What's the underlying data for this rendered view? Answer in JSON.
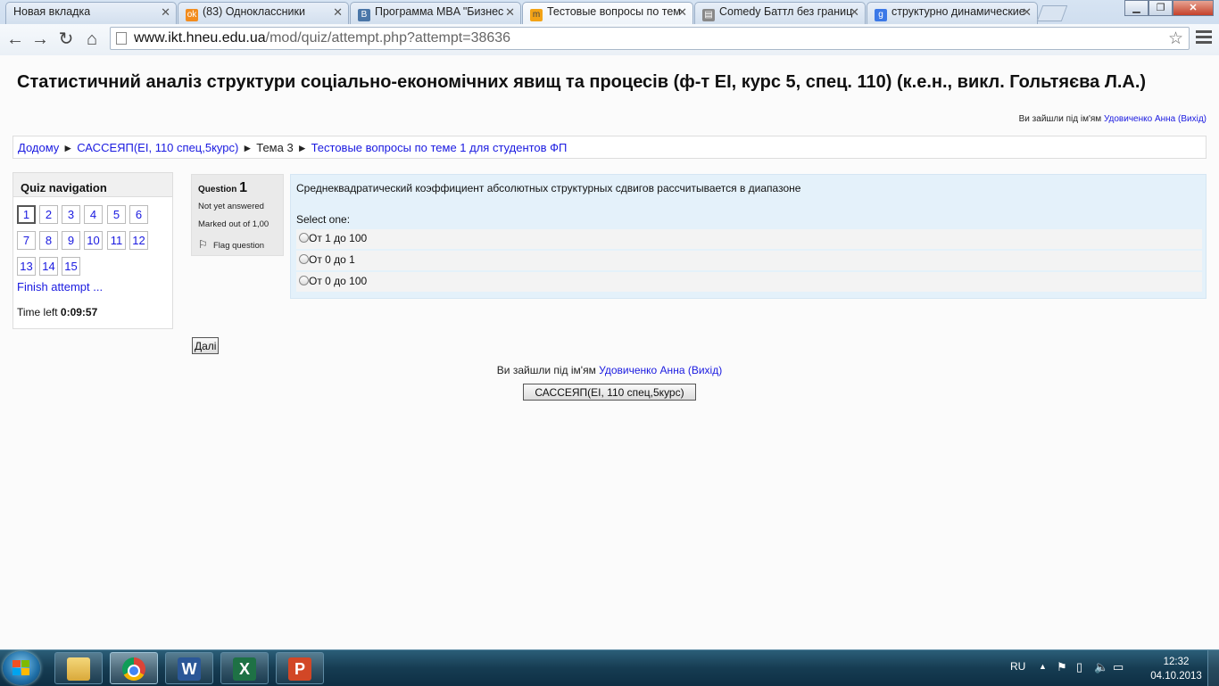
{
  "browser": {
    "tabs": [
      {
        "title": "Новая вкладка",
        "icon": "blank-page-icon",
        "active": false
      },
      {
        "title": "(83) Одноклассники",
        "icon": "odnoklassniki-icon",
        "active": false
      },
      {
        "title": "Программа MBA \"Бизнес",
        "icon": "vk-icon",
        "active": false
      },
      {
        "title": "Тестовые вопросы по теме",
        "icon": "moodle-icon",
        "active": true
      },
      {
        "title": "Comedy Баттл без границ",
        "icon": "film-icon",
        "active": false
      },
      {
        "title": "структурно динамические",
        "icon": "google-icon",
        "active": false
      }
    ],
    "url_host": "www.ikt.hneu.edu.ua",
    "url_path": "/mod/quiz/attempt.php?attempt=38636"
  },
  "page": {
    "course_title": "Статистичний аналіз структури соціально-економічних явищ та процесів (ф-т ЕІ, курс 5, спец. 110) (к.е.н., викл. Гольтяєва Л.А.)",
    "login_prefix": "Ви зайшли під ім'ям",
    "user_name": "Удовиченко Анна",
    "logout": "(Вихід)",
    "breadcrumb": [
      {
        "label": "Додому",
        "link": true
      },
      {
        "label": "САССЕЯП(ЕІ, 110 спец,5курс)",
        "link": true
      },
      {
        "label": "Тема 3",
        "link": false
      },
      {
        "label": "Тестовые вопросы по теме 1 для студентов ФП",
        "link": true
      }
    ],
    "breadcrumb_sep": "►"
  },
  "quiz_nav": {
    "title": "Quiz navigation",
    "questions": [
      "1",
      "2",
      "3",
      "4",
      "5",
      "6",
      "7",
      "8",
      "9",
      "10",
      "11",
      "12",
      "13",
      "14",
      "15"
    ],
    "current": "1",
    "finish_label": "Finish attempt ...",
    "time_label": "Time left",
    "time_value": "0:09:57"
  },
  "question": {
    "label": "Question",
    "number": "1",
    "state": "Not yet answered",
    "grade": "Marked out of 1,00",
    "flag_label": "Flag question",
    "text": "Среднеквадратический коэффициент абсолютных структурных сдвигов рассчитывается в диапазоне",
    "prompt": "Select one:",
    "answers": [
      "От 1 до 100",
      "От 0 до 1",
      "От 0 до 100"
    ]
  },
  "buttons": {
    "next": "Далі",
    "course": "САССЕЯП(ЕІ, 110 спец,5курс)"
  },
  "taskbar": {
    "apps": [
      "explorer-icon",
      "chrome-icon",
      "word-icon",
      "excel-icon",
      "powerpoint-icon"
    ],
    "lang": "RU",
    "time": "12:32",
    "date": "04.10.2013"
  }
}
